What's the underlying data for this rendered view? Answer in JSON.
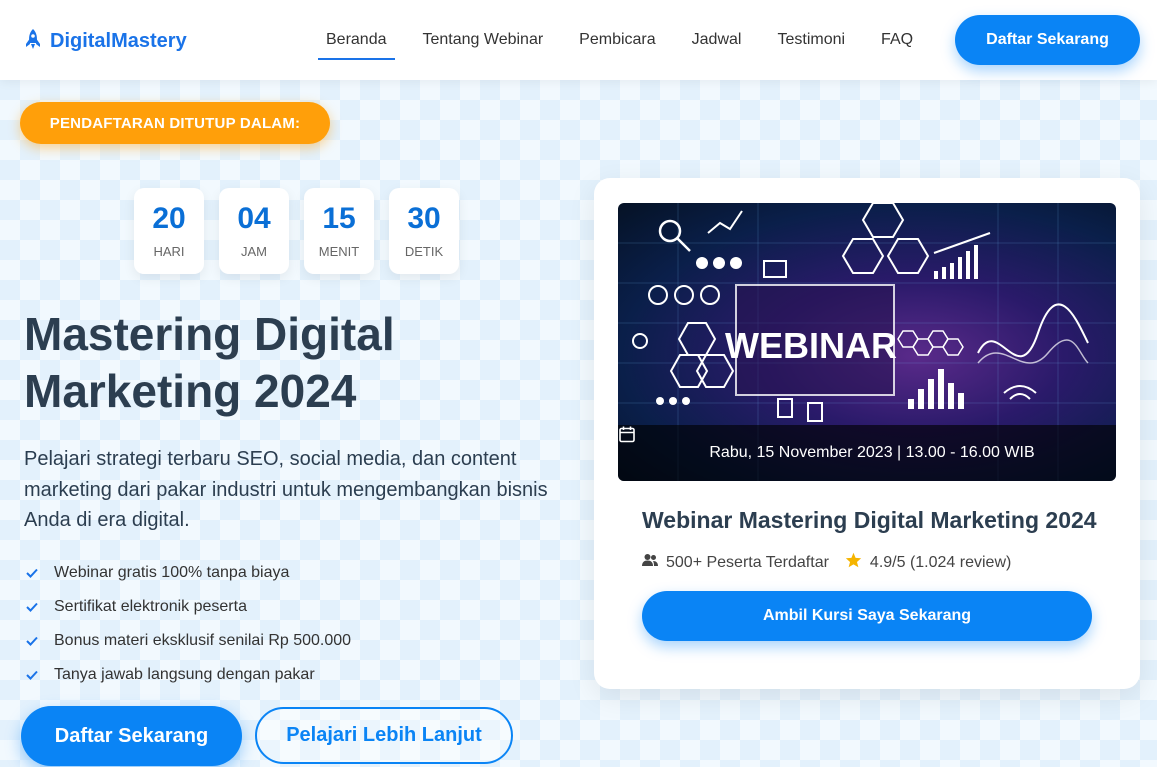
{
  "header": {
    "logo_text": "DigitalMastery",
    "nav": [
      {
        "label": "Beranda",
        "active": true
      },
      {
        "label": "Tentang Webinar"
      },
      {
        "label": "Pembicara"
      },
      {
        "label": "Jadwal"
      },
      {
        "label": "Testimoni"
      },
      {
        "label": "FAQ"
      }
    ],
    "cta_label": "Daftar Sekarang"
  },
  "hero": {
    "badge": "PENDAFTARAN DITUTUP DALAM:",
    "countdown": [
      {
        "value": "20",
        "label": "HARI"
      },
      {
        "value": "04",
        "label": "JAM"
      },
      {
        "value": "15",
        "label": "MENIT"
      },
      {
        "value": "30",
        "label": "DETIK"
      }
    ],
    "title": "Mastering Digital Marketing 2024",
    "description": "Pelajari strategi terbaru SEO, social media, dan content marketing dari pakar industri untuk mengembangkan bisnis Anda di era digital.",
    "features": [
      "Webinar gratis 100% tanpa biaya",
      "Sertifikat elektronik peserta",
      "Bonus materi eksklusif senilai Rp 500.000",
      "Tanya jawab langsung dengan pakar"
    ],
    "primary_button": "Daftar Sekarang",
    "secondary_button": "Pelajari Lebih Lanjut"
  },
  "card": {
    "image_text": "WEBINAR",
    "schedule": "Rabu, 15 November 2023 | 13.00 - 16.00 WIB",
    "title": "Webinar Mastering Digital Marketing 2024",
    "participants": "500+ Peserta Terdaftar",
    "rating": "4.9/5 (1.024 review)",
    "button": "Ambil Kursi Saya Sekarang"
  },
  "colors": {
    "primary": "#0a84f5",
    "accent": "#ff9f0a",
    "text": "#2c3e50",
    "star": "#f5b400"
  },
  "icons": {
    "logo": "rocket-icon",
    "feature": "check-icon",
    "schedule": "calendar-icon",
    "participants": "users-icon",
    "rating": "star-icon"
  }
}
